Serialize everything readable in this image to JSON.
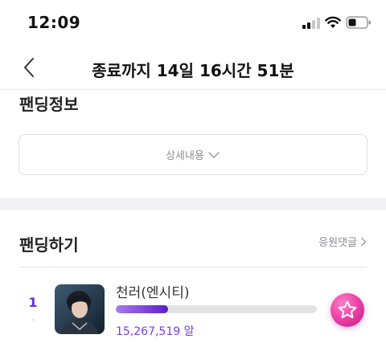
{
  "status_bar": {
    "time": "12:09",
    "signal_icon": "cellular-signal-icon",
    "wifi_icon": "wifi-icon",
    "battery_icon": "battery-icon"
  },
  "header": {
    "back_icon": "chevron-left-icon",
    "title": "종료까지 14일 16시간 51분"
  },
  "funding_info": {
    "title": "팬딩정보",
    "detail_label": "상세내용",
    "detail_icon": "chevron-down-icon"
  },
  "funding": {
    "title": "팬딩하기",
    "cheer_link_label": "응원댓글",
    "cheer_link_icon": "chevron-right-icon",
    "rankings": [
      {
        "rank": "1",
        "rank_change": "-",
        "name": "천러(엔시티)",
        "progress_fraction": 0.26,
        "amount": "15,267,519 알"
      }
    ]
  },
  "fab": {
    "icon": "star-icon"
  },
  "colors": {
    "accent": "#6c2ed1",
    "progress_fill": "#5b1fc7",
    "fab": "#e83aa3",
    "muted_text": "#8c8c92",
    "section_band": "#f3f3f5"
  }
}
